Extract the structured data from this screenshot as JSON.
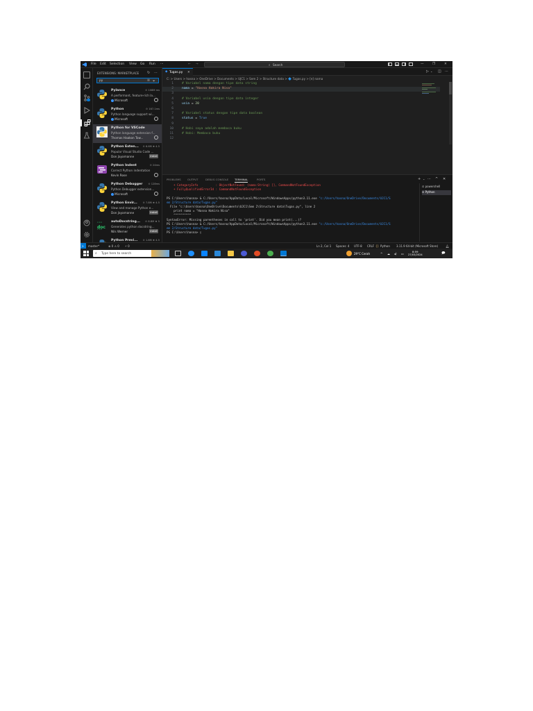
{
  "window": {
    "menu": [
      "File",
      "Edit",
      "Selection",
      "View",
      "Go",
      "Run",
      "···"
    ],
    "search_label": "Search"
  },
  "sidebar": {
    "title": "EXTENSIONS: MARKETPLACE",
    "search_value": "py",
    "extensions": [
      {
        "name": "Pylance",
        "meta": "⊙ 108M ms",
        "desc": "A performant, feature-rich la...",
        "publisher": "Microsoft",
        "verified": true,
        "action": "gear",
        "logo": "python-logo"
      },
      {
        "name": "Python",
        "meta": "⊙ 167.1ms",
        "desc": "Python language support wi...",
        "publisher": "Microsoft",
        "verified": true,
        "action": "gear",
        "logo": "python-logo"
      },
      {
        "name": "Python for VSCode",
        "meta": "",
        "desc": "Python language extension f...",
        "publisher": "Thomas Haakon Tow...",
        "verified": false,
        "action": "gear",
        "logo": "python-vscode-logo",
        "selected": true
      },
      {
        "name": "Python Exten...",
        "meta": "⊙ 6.6M ★ 4.5",
        "desc": "Popular Visual Studio Code ...",
        "publisher": "Don Jayamanne",
        "verified": false,
        "action": "install",
        "logo": "python-logo"
      },
      {
        "name": "Python Indent",
        "meta": "⊙ 24ms",
        "desc": "Correct Python indentation",
        "publisher": "Kevin Rose",
        "verified": false,
        "action": "gear",
        "logo": "indent-logo"
      },
      {
        "name": "Python Debugger",
        "meta": "⊙ 128ms",
        "desc": "Python Debugger extension...",
        "publisher": "Microsoft",
        "verified": true,
        "action": "gear",
        "logo": "python-logo"
      },
      {
        "name": "Python Envir...",
        "meta": "⊙ 7.8M ★ 4.5",
        "desc": "View and manage Python e...",
        "publisher": "Don Jayamanne",
        "verified": false,
        "action": "install",
        "logo": "python-logo"
      },
      {
        "name": "autoDocstring...",
        "meta": "⊙ 8.8M ★ 5",
        "desc": "Generates python docstring...",
        "publisher": "Nils Werner",
        "verified": false,
        "action": "install",
        "logo": "doc-logo"
      },
      {
        "name": "Python Previ...",
        "meta": "⊙ 1.8M ★ 4.5",
        "desc": "",
        "publisher": "",
        "verified": false,
        "action": "",
        "logo": "python-logo"
      }
    ],
    "install_label": "Install"
  },
  "editor": {
    "tab_label": "Tugas.py",
    "breadcrumb": "C: > Users > hasna > OneDrive > Documents > UJC1 > Sem 2 > Structure data > 🔷 Tugas.py > [e] nama",
    "lines": [
      {
        "n": "1",
        "parts": [
          {
            "t": "# Variabel nama dengan tipe data string",
            "c": "cm"
          }
        ]
      },
      {
        "n": "2",
        "parts": [
          {
            "t": "nama",
            "c": "var"
          },
          {
            "t": " = ",
            "c": "op"
          },
          {
            "t": "\"Hasna Hakira Nisa\"",
            "c": "str"
          }
        ],
        "highlight": true
      },
      {
        "n": "3",
        "parts": []
      },
      {
        "n": "4",
        "parts": [
          {
            "t": "# Variabel usia dengan tipe data integer",
            "c": "cm"
          }
        ]
      },
      {
        "n": "5",
        "parts": [
          {
            "t": "usia",
            "c": "var"
          },
          {
            "t": " = ",
            "c": "op"
          },
          {
            "t": "20",
            "c": "num"
          }
        ]
      },
      {
        "n": "6",
        "parts": []
      },
      {
        "n": "7",
        "parts": [
          {
            "t": "# Variabel status dengan tipe data boolean",
            "c": "cm"
          }
        ]
      },
      {
        "n": "8",
        "parts": [
          {
            "t": "status",
            "c": "var"
          },
          {
            "t": " = ",
            "c": "op"
          },
          {
            "t": "True",
            "c": "kw"
          }
        ]
      },
      {
        "n": "9",
        "parts": []
      },
      {
        "n": "10",
        "parts": [
          {
            "t": "# Hobi saya adalah membaca buku",
            "c": "cm"
          }
        ]
      },
      {
        "n": "11",
        "parts": [
          {
            "t": "# Hobi: Membaca buku",
            "c": "cm"
          }
        ]
      },
      {
        "n": "12",
        "parts": []
      }
    ]
  },
  "panel": {
    "tabs": [
      "PROBLEMS",
      "OUTPUT",
      "DEBUG CONSOLE",
      "TERMINAL",
      "PORTS"
    ],
    "active_tab": "TERMINAL",
    "terminal_lines": [
      {
        "parts": [
          {
            "t": "    + CategoryInfo          : ObjectNotFound: (nama:String) [], CommandNotFoundException",
            "c": "err"
          }
        ]
      },
      {
        "parts": [
          {
            "t": "    + FullyQualifiedErrorId : CommandNotFoundException",
            "c": "err"
          }
        ]
      },
      {
        "parts": []
      },
      {
        "parts": [
          {
            "t": "PS C:\\Users\\hasna> & C:/Users/hasna/AppData/Local/Microsoft/WindowsApps/python3.11.exe ",
            "c": ""
          },
          {
            "t": "\"c:/Users/hasna/OneDrive/Documents/UJC1/S",
            "c": "path"
          }
        ]
      },
      {
        "parts": [
          {
            "t": "em 2/Structure data/Tugas.py\"",
            "c": "path"
          }
        ]
      },
      {
        "parts": [
          {
            "t": "  File \"c:\\Users\\hasna\\OneDrive\\Documents\\UJC1\\Sem 2\\Structure data\\Tugas.py\", line 2",
            "c": ""
          }
        ]
      },
      {
        "parts": [
          {
            "t": "    print nama = \"Hasna Hakira Nisa\"",
            "c": ""
          }
        ]
      },
      {
        "parts": [
          {
            "t": "    ^^^^^^^^^^",
            "c": ""
          }
        ]
      },
      {
        "parts": [
          {
            "t": "SyntaxError: Missing parentheses in call to 'print'. Did you mean print(...)?",
            "c": ""
          }
        ]
      },
      {
        "parts": [
          {
            "t": "PS C:\\Users\\hasna> & C:/Users/hasna/AppData/Local/Microsoft/WindowsApps/python3.11.exe ",
            "c": ""
          },
          {
            "t": "\"c:/Users/hasna/OneDrive/Documents/UJC1/S",
            "c": "path"
          }
        ]
      },
      {
        "parts": [
          {
            "t": "em 2/Structure data/Tugas.py\"",
            "c": "path"
          }
        ]
      },
      {
        "parts": [
          {
            "t": "PS C:\\Users\\hasna> ▯",
            "c": ""
          }
        ]
      }
    ],
    "terminals": [
      "powershell",
      "Python"
    ]
  },
  "statusbar": {
    "branch": "master*",
    "problems": "⊗ 0 ⚠ 0",
    "ports": "⚡ 0",
    "position": "Ln 2, Col 1",
    "spaces": "Spaces: 4",
    "encoding": "UTF-8",
    "eol": "CRLF",
    "language": "Python",
    "interpreter": "3.11.9 64-bit (Microsoft Store)"
  },
  "taskbar": {
    "search_placeholder": "Type here to search",
    "weather": "29°C  Cerah",
    "time": "8:59",
    "date": "27/03/2024"
  },
  "colors": {
    "accent": "#0078d4",
    "editor_bg": "#1f1f1f",
    "sidebar_bg": "#181818"
  }
}
